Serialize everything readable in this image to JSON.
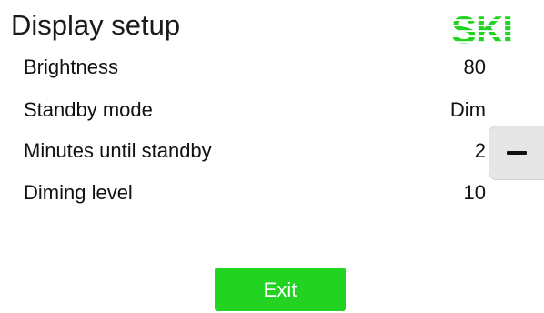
{
  "header": {
    "title": "Display setup",
    "logo_text": "SKI"
  },
  "settings": [
    {
      "label": "Brightness",
      "value": "80"
    },
    {
      "label": "Standby mode",
      "value": "Dim"
    },
    {
      "label": "Minutes until standby",
      "value": "2"
    },
    {
      "label": "Diming level",
      "value": "10"
    }
  ],
  "controls": {
    "decrement_icon": "minus-icon"
  },
  "footer": {
    "exit_label": "Exit"
  },
  "colors": {
    "brand_green": "#22d322",
    "exit_button": "#22d322",
    "stepper_bg": "#e6e6e6"
  }
}
